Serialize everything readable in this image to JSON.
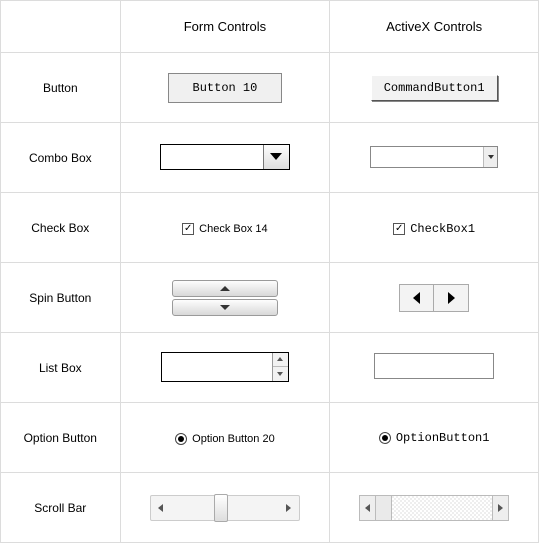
{
  "headers": {
    "label": "",
    "form": "Form Controls",
    "activex": "ActiveX Controls"
  },
  "rows": {
    "button": {
      "label": "Button",
      "form_text": "Button 10",
      "ax_text": "CommandButton1"
    },
    "combo": {
      "label": "Combo Box"
    },
    "check": {
      "label": "Check Box",
      "form_text": "Check Box 14",
      "ax_text": "CheckBox1",
      "form_checked": true,
      "ax_checked": true
    },
    "spin": {
      "label": "Spin Button"
    },
    "list": {
      "label": "List Box"
    },
    "option": {
      "label": "Option Button",
      "form_text": "Option Button 20",
      "ax_text": "OptionButton1",
      "form_selected": true,
      "ax_selected": true
    },
    "scroll": {
      "label": "Scroll Bar"
    }
  }
}
